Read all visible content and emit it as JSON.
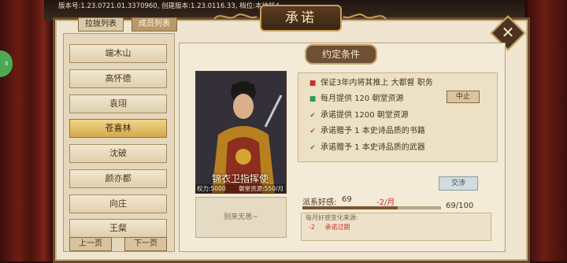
{
  "version_text": "版本号:1.23.0721.01.3370960, 创建版本:1.23.0116.33, 档位:本地档4",
  "side_badge": "3",
  "dialog": {
    "title": "承诺",
    "close_label": "✕"
  },
  "tabs": [
    {
      "label": "拉拢列表"
    },
    {
      "label": "成员列表"
    }
  ],
  "members": [
    {
      "name": "端木山"
    },
    {
      "name": "高怀德"
    },
    {
      "name": "袁珝"
    },
    {
      "name": "苍喜林"
    },
    {
      "name": "沈破"
    },
    {
      "name": "颜亦都"
    },
    {
      "name": "向庄"
    },
    {
      "name": "王粲"
    }
  ],
  "paging": {
    "prev": "上一页",
    "next": "下一页"
  },
  "condition_title": "约定条件",
  "character": {
    "title": "锦衣卫指挥使",
    "power": "权力:5000",
    "resource": "朝堂资源:550/月",
    "no_item": "别来无恙~"
  },
  "terms": [
    {
      "text": "保证3年内将其推上 大都督 职务",
      "marker": "red"
    },
    {
      "text": "每月提供 120 朝堂资源",
      "marker": "green"
    },
    {
      "text": "承诺提供 1200 朝堂资源",
      "marker": "check"
    },
    {
      "text": "承诺赠予 1 本史诗品质的书籍",
      "marker": "check"
    },
    {
      "text": "承诺赠予 1 本史诗品质的武器",
      "marker": "check"
    }
  ],
  "stop_button": "中止",
  "negotiate_button": "交涉",
  "favor": {
    "label": "派系好感:",
    "value": "69",
    "rate": "-2/月",
    "progress_text": "69/100",
    "progress": 0.69
  },
  "monthly": {
    "title": "每月好感变化来源:",
    "rows": [
      {
        "value": "-2",
        "reason": "承诺过期"
      }
    ]
  },
  "colors": {
    "accent_red": "#c53030",
    "panel": "#efe5d0",
    "selected": "#e0b55c"
  }
}
